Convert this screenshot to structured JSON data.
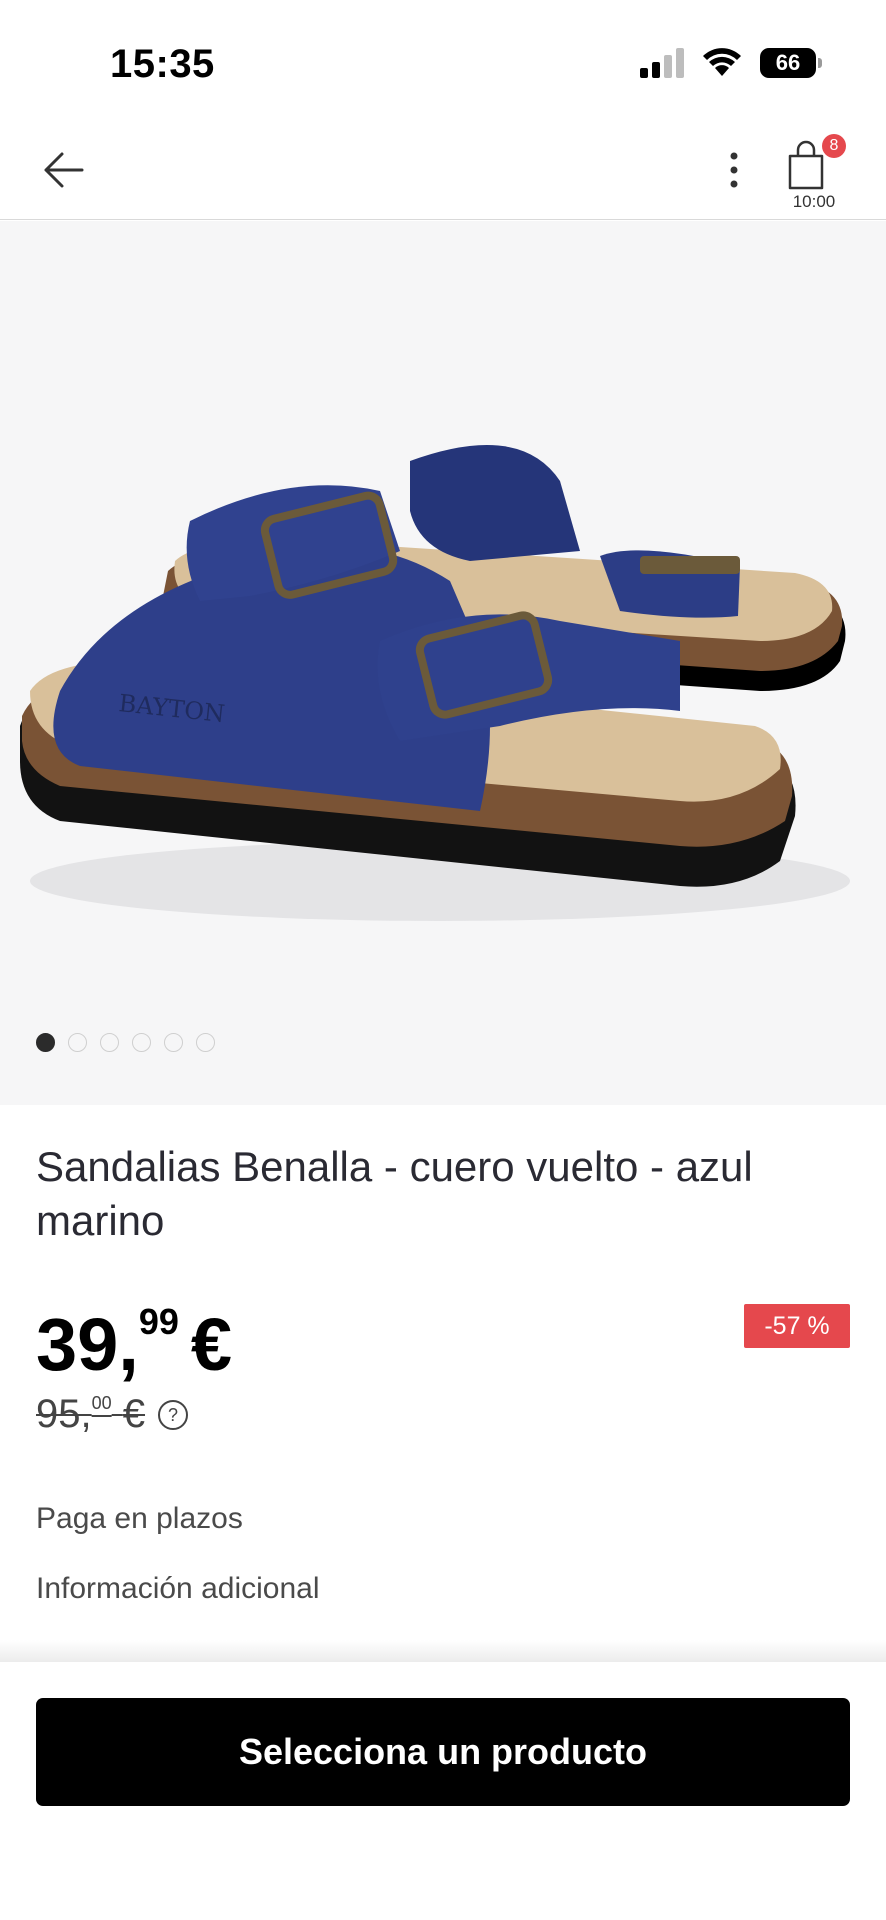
{
  "status_bar": {
    "time": "15:35",
    "battery_level": "66",
    "icons": [
      "cellular-signal-icon",
      "wifi-icon",
      "battery-icon"
    ]
  },
  "nav": {
    "icons": [
      "back-arrow-icon",
      "more-vertical-icon",
      "shopping-bag-icon"
    ],
    "cart_count": "8",
    "cart_time": "10:00"
  },
  "gallery": {
    "image_count": 6,
    "active_index": 0,
    "product_image": "navy-suede-two-strap-sandal",
    "brand_emboss": "BAYTON"
  },
  "product": {
    "title": "Sandalias Benalla - cuero vuelto - azul marino",
    "price_int": "39,",
    "price_dec": "99",
    "price_currency": "€",
    "old_price_int": "95,",
    "old_price_dec": "00",
    "old_price_currency": "€",
    "discount": "-57 %"
  },
  "links": {
    "installments": "Paga en plazos",
    "additional_info": "Información adicional"
  },
  "cta": {
    "label": "Selecciona un producto"
  },
  "colors": {
    "accent_red": "#e5484d",
    "cta_background": "#000000",
    "gallery_background": "#f6f6f7",
    "sandal_navy": "#2e3f8a"
  }
}
